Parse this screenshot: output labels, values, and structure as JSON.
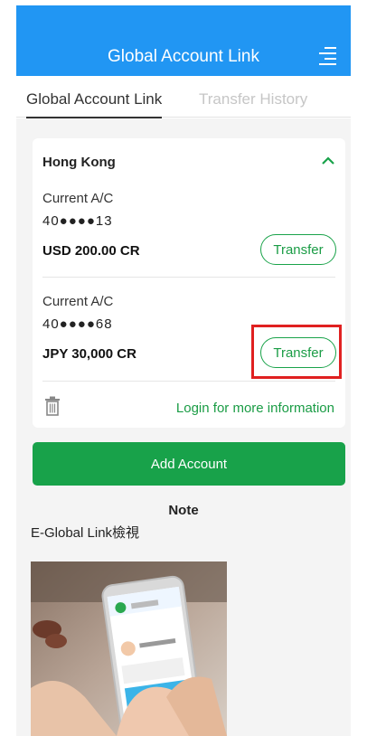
{
  "header": {
    "title": "Global Account Link",
    "menu_icon": "menu-icon"
  },
  "tabs": [
    {
      "label": "Global Account Link",
      "active": true
    },
    {
      "label": "Transfer History",
      "active": false
    }
  ],
  "card": {
    "region": "Hong Kong",
    "accounts": [
      {
        "type": "Current A/C",
        "number": "40●●●●13",
        "amount": "USD 200.00 CR",
        "action": "Transfer"
      },
      {
        "type": "Current A/C",
        "number": "40●●●●68",
        "amount": "JPY 30,000 CR",
        "action": "Transfer"
      }
    ],
    "login_link": "Login for more information"
  },
  "add_account_label": "Add Account",
  "note": {
    "title": "Note",
    "subtitle": "E-Global Link檢視"
  },
  "colors": {
    "header_blue": "#2196f3",
    "accent_green": "#18a24a",
    "highlight_red": "#e02020"
  }
}
